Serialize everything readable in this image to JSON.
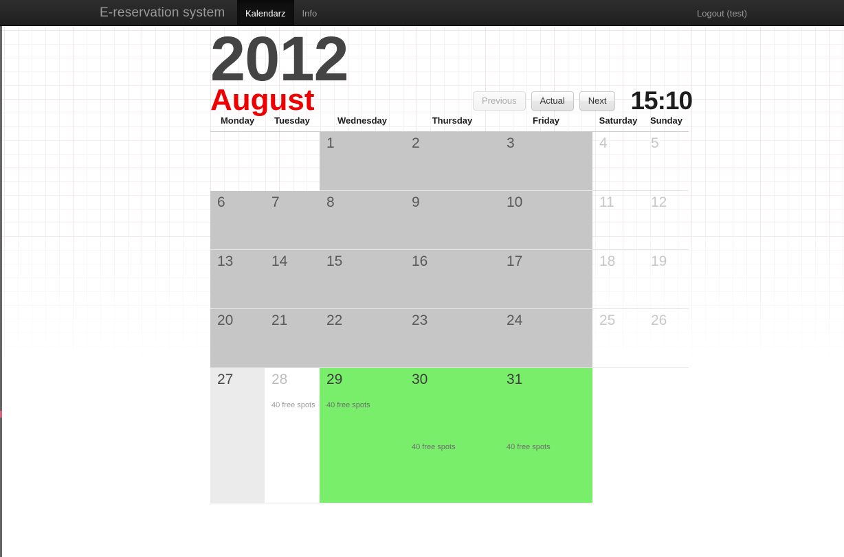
{
  "navbar": {
    "brand": "E-reservation system",
    "links": [
      {
        "label": "Kalendarz",
        "active": true
      },
      {
        "label": "Info",
        "active": false
      }
    ],
    "logout": "Logout (test)"
  },
  "header": {
    "year": "2012",
    "month": "August",
    "clock": "15:10",
    "buttons": {
      "previous": "Previous",
      "actual": "Actual",
      "next": "Next"
    }
  },
  "calendar": {
    "weekdays": [
      "Monday",
      "Tuesday",
      "Wednesday",
      "Thursday",
      "Friday",
      "Saturday",
      "Sunday"
    ],
    "colors": {
      "past": "#c6c6c6",
      "free": "#79ee6b",
      "today": "#ebebeb",
      "month_accent": "#ef0000",
      "year_text": "#444444"
    },
    "weeks": [
      [
        {
          "day": "",
          "state": "empty",
          "spots": ""
        },
        {
          "day": "",
          "state": "empty",
          "spots": ""
        },
        {
          "day": "1",
          "state": "past",
          "spots": ""
        },
        {
          "day": "2",
          "state": "past",
          "spots": ""
        },
        {
          "day": "3",
          "state": "past",
          "spots": ""
        },
        {
          "day": "4",
          "state": "weekend",
          "spots": ""
        },
        {
          "day": "5",
          "state": "weekend",
          "spots": ""
        }
      ],
      [
        {
          "day": "6",
          "state": "past",
          "spots": ""
        },
        {
          "day": "7",
          "state": "past",
          "spots": ""
        },
        {
          "day": "8",
          "state": "past",
          "spots": ""
        },
        {
          "day": "9",
          "state": "past",
          "spots": ""
        },
        {
          "day": "10",
          "state": "past",
          "spots": ""
        },
        {
          "day": "11",
          "state": "weekend",
          "spots": ""
        },
        {
          "day": "12",
          "state": "weekend",
          "spots": ""
        }
      ],
      [
        {
          "day": "13",
          "state": "past",
          "spots": ""
        },
        {
          "day": "14",
          "state": "past",
          "spots": ""
        },
        {
          "day": "15",
          "state": "past",
          "spots": ""
        },
        {
          "day": "16",
          "state": "past",
          "spots": ""
        },
        {
          "day": "17",
          "state": "past",
          "spots": ""
        },
        {
          "day": "18",
          "state": "weekend",
          "spots": ""
        },
        {
          "day": "19",
          "state": "weekend",
          "spots": ""
        }
      ],
      [
        {
          "day": "20",
          "state": "past",
          "spots": ""
        },
        {
          "day": "21",
          "state": "past",
          "spots": ""
        },
        {
          "day": "22",
          "state": "past",
          "spots": ""
        },
        {
          "day": "23",
          "state": "past",
          "spots": ""
        },
        {
          "day": "24",
          "state": "past",
          "spots": ""
        },
        {
          "day": "25",
          "state": "weekend",
          "spots": ""
        },
        {
          "day": "26",
          "state": "weekend",
          "spots": ""
        }
      ],
      [
        {
          "day": "27",
          "state": "today",
          "spots": ""
        },
        {
          "day": "28",
          "state": "plain",
          "spots": "40 free spots",
          "spotsPos": "hi"
        },
        {
          "day": "29",
          "state": "free",
          "spots": "40 free spots",
          "spotsPos": "hi"
        },
        {
          "day": "30",
          "state": "free",
          "spots": "40 free spots",
          "spotsPos": "lo"
        },
        {
          "day": "31",
          "state": "free",
          "spots": "40 free spots",
          "spotsPos": "lo"
        },
        {
          "day": "",
          "state": "blank",
          "spots": ""
        },
        {
          "day": "",
          "state": "blank",
          "spots": ""
        }
      ]
    ]
  }
}
